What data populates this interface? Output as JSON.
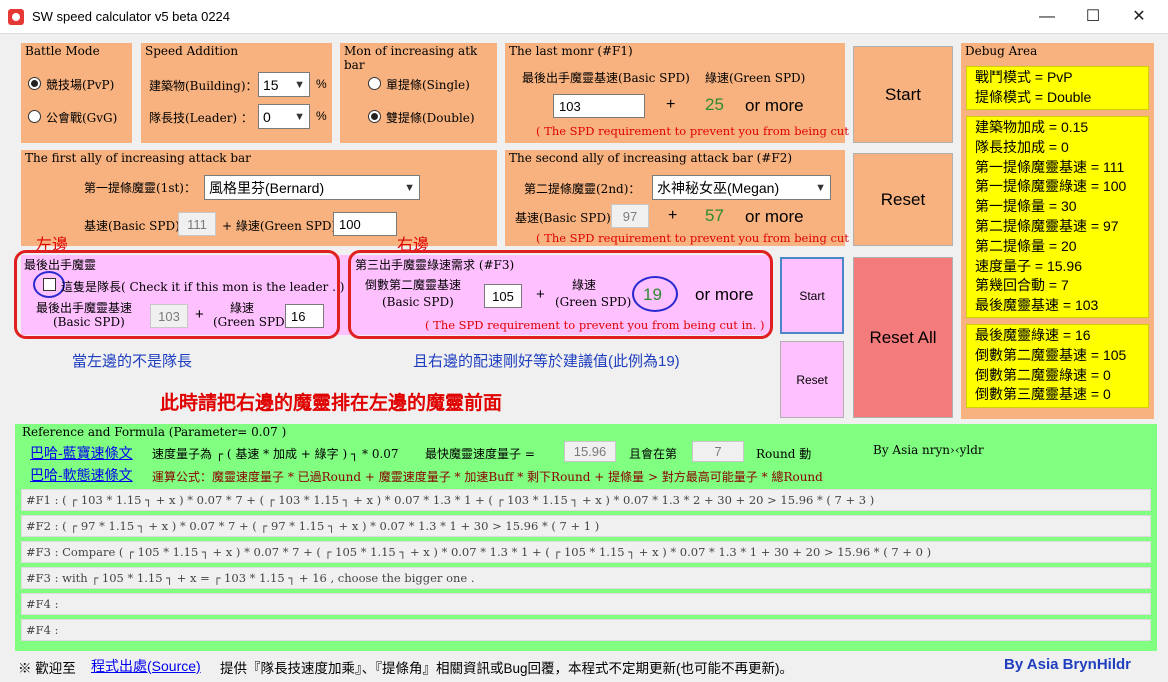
{
  "window": {
    "title": "SW speed calculator v5 beta 0224",
    "minimize": "—",
    "maximize": "☐",
    "close": "✕"
  },
  "battle_mode": {
    "title": "Battle Mode",
    "options": [
      "競技場(PvP)",
      "公會戰(GvG)"
    ],
    "selected": 0
  },
  "speed_addition": {
    "title": "Speed Addition",
    "building_label": "建築物(Building)：",
    "building_value": "15",
    "leader_label": "隊長技(Leader) ：",
    "leader_value": "0",
    "unit": "%"
  },
  "increase_bar": {
    "title": "Mon of increasing atk bar",
    "options": [
      "單提條(Single)",
      "雙提條(Double)"
    ],
    "selected": 1
  },
  "last_monr": {
    "title": "The last monr (#F1)",
    "basic_label": "最後出手魔靈基速(Basic SPD)",
    "green_label": "綠速(Green SPD)",
    "basic_value": "103",
    "plus": "+",
    "green_value": "25",
    "or_more": "or more",
    "warning": "( The SPD requirement to prevent you from being cut in. )"
  },
  "first_ally": {
    "title": "The first ally of increasing attack bar",
    "mon_label": "第一提條魔靈(1st)：",
    "mon_value": "風格里芬(Bernard)",
    "basic_label": "基速(Basic SPD)",
    "basic_value": "111",
    "green_label": "+ 綠速(Green SPD)",
    "green_value": "100"
  },
  "second_ally": {
    "title": "The second ally of increasing attack bar (#F2)",
    "mon_label": "第二提條魔靈(2nd)：",
    "mon_value": "水神秘女巫(Megan)",
    "basic_label": "基速(Basic SPD)",
    "basic_value": "97",
    "plus": "+",
    "green_value": "57",
    "or_more": "or more",
    "warning": "( The SPD requirement to prevent you from being cut in. )"
  },
  "last_mon_pink": {
    "title": "最後出手魔靈",
    "leader_check_label": "這隻是隊長( Check it if this mon is the leader . )",
    "basic_label_1": "最後出手魔靈基速",
    "basic_label_2": "(Basic SPD)",
    "plus": "+",
    "green_label_1": "綠速",
    "green_label_2": "(Green SPD)",
    "basic_value": "103",
    "green_value": "16"
  },
  "third_req": {
    "title": "第三出手魔靈綠速需求 (#F3)",
    "basic_label_1": "倒數第二魔靈基速",
    "basic_label_2": "(Basic SPD)",
    "basic_value": "105",
    "plus": "+",
    "green_label_1": "綠速",
    "green_label_2": "(Green SPD)",
    "green_value": "19",
    "or_more": "or more",
    "warning": "( The SPD requirement to prevent you from being cut in. )"
  },
  "buttons": {
    "start_top": "Start",
    "reset_top": "Reset",
    "start_mid": "Start",
    "reset_mid": "Reset",
    "reset_all": "Reset All"
  },
  "annotations": {
    "left": "左邊",
    "right": "右邊",
    "note_left": "當左邊的不是隊長",
    "note_right": "且右邊的配速剛好等於建議值(此例為19)",
    "main": "此時請把右邊的魔靈排在左邊的魔靈前面"
  },
  "debug": {
    "title": "Debug Area",
    "box1": [
      "戰鬥模式 = PvP",
      "提條模式 = Double"
    ],
    "box2": [
      "建築物加成 = 0.15",
      "隊長技加成 = 0",
      "第一提條魔靈基速 = 111",
      "第一提條魔靈綠速 = 100",
      "第一提條量 = 30",
      "第二提條魔靈基速 = 97",
      "第二提條量 = 20",
      "速度量子 = 15.96",
      "第幾回合動 = 7",
      "最後魔靈基速 = 103"
    ],
    "box3": [
      "最後魔靈綠速 = 16",
      "倒數第二魔靈基速 = 105",
      "倒數第二魔靈綠速 = 0",
      "倒數第三魔靈基速 = 0"
    ]
  },
  "reference": {
    "title": "Reference and Formula (Parameter= 0.07 )",
    "link1": "巴哈-藍寶速條文",
    "formula1_a": "速度量子為 ┌ ( 基速 * 加成 + 綠字 ) ┐ * 0.07",
    "formula1_b": "最快魔靈速度量子 =",
    "quantum_value": "15.96",
    "formula1_c": "且會在第",
    "round_value": "7",
    "formula1_d": "Round 動",
    "author_small": "By Asia nryn›‹yldr",
    "link2": "巴哈-軟態速條文",
    "formula2": "運算公式：魔靈速度量子 * 已過Round + 魔靈速度量子 * 加速Buff * 剩下Round + 提條量 > 對方最高可能量子 * 總Round",
    "rows": [
      "#F1 : ( ┌ 103 * 1.15 ┐ + x ) * 0.07 * 7 + ( ┌ 103 * 1.15 ┐ + x ) * 0.07 * 1.3 * 1 + ( ┌ 103 * 1.15 ┐ + x ) * 0.07 * 1.3 * 2 + 30 + 20 > 15.96 * ( 7 + 3 )",
      "#F2 : ( ┌ 97 * 1.15 ┐ + x ) * 0.07 * 7 + ( ┌ 97 * 1.15 ┐ + x ) * 0.07 * 1.3 * 1 + 30 > 15.96 * ( 7 + 1 )",
      "#F3 : Compare  ( ┌ 105 * 1.15 ┐ + x ) * 0.07 * 7 + ( ┌ 105 * 1.15 ┐ + x ) * 0.07 * 1.3 * 1 + ( ┌ 105 * 1.15 ┐ + x ) * 0.07 * 1.3 * 1 + 30 + 20 > 15.96 * ( 7 + 0 )",
      "#F3 :        with   ┌ 105 * 1.15 ┐ + x  =   ┌ 103 * 1.15 ┐ + 16  , choose the bigger one .",
      "#F4 :",
      "#F4 :"
    ]
  },
  "footer": {
    "prefix": "※ 歡迎至",
    "link": "程式出處(Source)",
    "suffix": "提供『隊長技速度加乘』、『提條角』相關資訊或Bug回覆，本程式不定期更新(也可能不再更新)。",
    "author": "By Asia BrynHildr"
  },
  "colors": {
    "orange_panel": "#f7b27f",
    "pink_panel": "#ffc0ff",
    "green_panel": "#80ff80",
    "debug_yellow": "#ffff00",
    "reset_all_red": "#f47b7b",
    "green_value": "#2e8b2e",
    "warning_red": "#e00000"
  }
}
